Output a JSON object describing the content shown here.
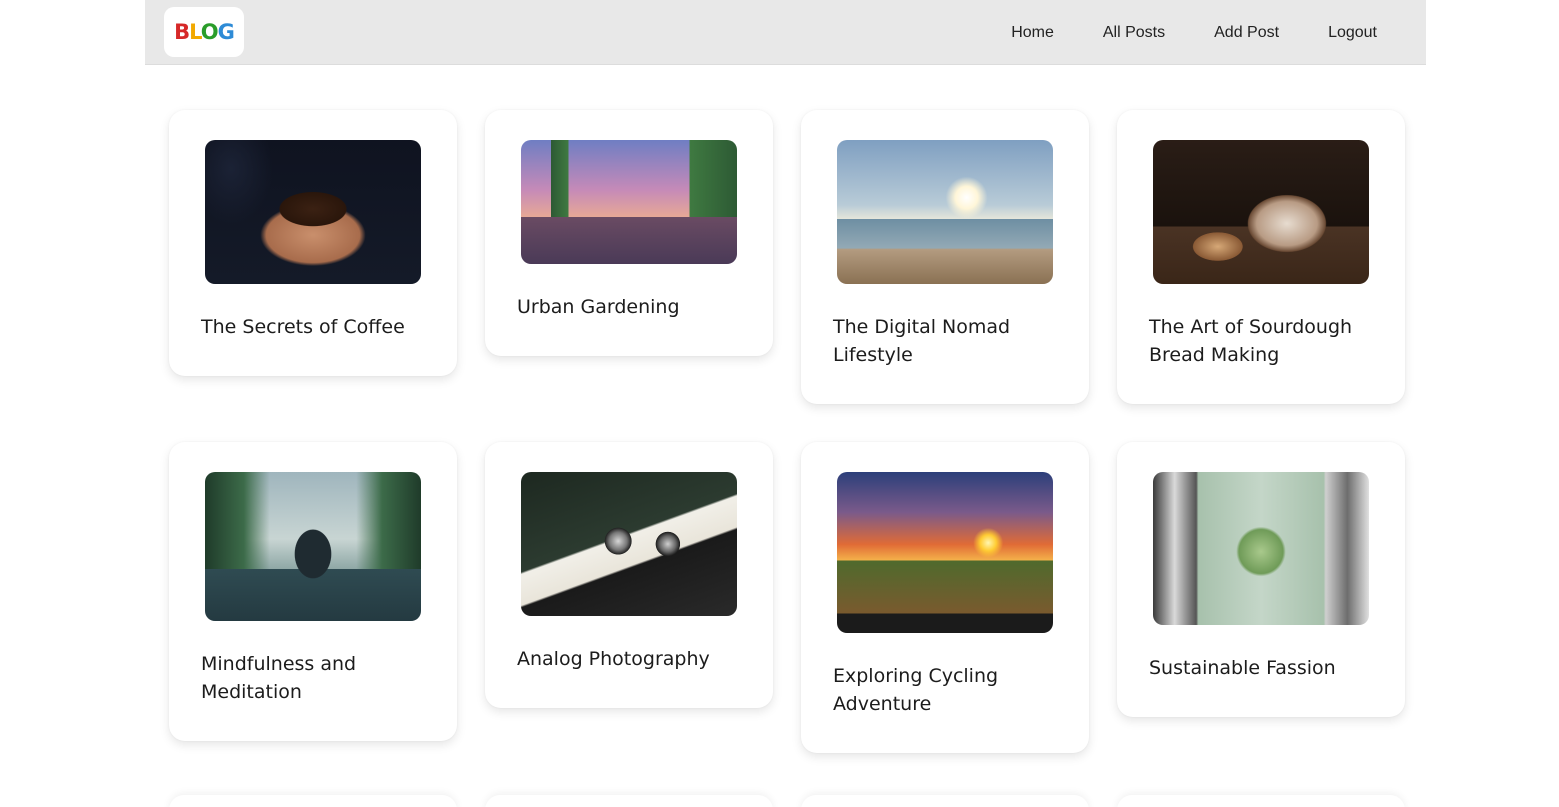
{
  "nav": {
    "logo_text": "BLOG",
    "links": [
      {
        "label": "Home"
      },
      {
        "label": "All Posts"
      },
      {
        "label": "Add Post"
      },
      {
        "label": "Logout"
      }
    ]
  },
  "posts": [
    {
      "title": "The Secrets of Coffee",
      "image": "coffee-beans-in-hands"
    },
    {
      "title": "Urban Gardening",
      "image": "rooftop-garden-city-view"
    },
    {
      "title": "The Digital Nomad Lifestyle",
      "image": "man-laptop-beach"
    },
    {
      "title": "The Art of Sourdough Bread Making",
      "image": "sourdough-bread-loaf"
    },
    {
      "title": "Mindfulness and Meditation",
      "image": "person-meditating-lake"
    },
    {
      "title": "Analog Photography",
      "image": "film-rolls-camera"
    },
    {
      "title": "Exploring Cycling Adventure",
      "image": "cyclists-sunset-trail"
    },
    {
      "title": "Sustainable Fassion",
      "image": "recycle-clothes-collage"
    }
  ],
  "colors": {
    "navbar_bg": "#e8e8e8",
    "card_bg": "#ffffff",
    "page_bg": "#ffffff"
  }
}
